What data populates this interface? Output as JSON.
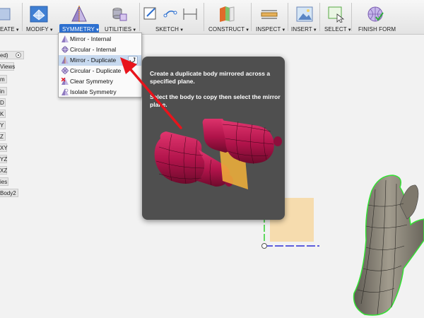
{
  "toolbar": {
    "groups": [
      {
        "label": "EATE",
        "icon": "create-solid-icon"
      },
      {
        "label": "MODIFY",
        "icon": "modify-icon"
      },
      {
        "label": "SYMMETRY",
        "icon": "symmetry-icon",
        "active": true
      },
      {
        "label": "UTILITIES",
        "icon": "utilities-icon"
      },
      {
        "label": "SKETCH",
        "icon": "sketch-icon"
      },
      {
        "label": "CONSTRUCT",
        "icon": "construct-icon"
      },
      {
        "label": "INSPECT",
        "icon": "inspect-icon"
      },
      {
        "label": "INSERT",
        "icon": "insert-image-icon"
      },
      {
        "label": "SELECT",
        "icon": "select-icon"
      },
      {
        "label": "FINISH FORM",
        "icon": "finish-form-icon"
      }
    ],
    "caret": "▼"
  },
  "browser": {
    "items": [
      "ed)",
      "Views",
      "m",
      "in",
      "D",
      "K",
      "Y",
      "Z",
      "XY",
      "YZ",
      "XZ",
      "ies",
      "Body2"
    ]
  },
  "symmetry_menu": {
    "items": [
      {
        "label": "Mirror - Internal",
        "icon": "mirror-internal-icon"
      },
      {
        "label": "Circular - Internal",
        "icon": "circular-internal-icon"
      },
      {
        "label": "Mirror - Duplicate",
        "icon": "mirror-duplicate-icon",
        "highlighted": true
      },
      {
        "label": "Circular - Duplicate",
        "icon": "circular-duplicate-icon"
      },
      {
        "label": "Clear Symmetry",
        "icon": "clear-symmetry-icon"
      },
      {
        "label": "Isolate Symmetry",
        "icon": "isolate-symmetry-icon"
      }
    ]
  },
  "tooltip": {
    "description": "Create a duplicate body mirrored across a specified plane.",
    "instruction": "Select the body to copy then select the mirror plane."
  },
  "colors": {
    "accent": "#2c6fcf",
    "highlight": "#c7d9ef",
    "arrow": "#e8141c",
    "tooltip_bg": "#4f4f4f",
    "body": "#b0134a"
  }
}
